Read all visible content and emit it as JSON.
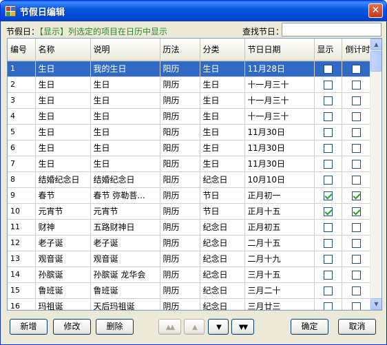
{
  "window": {
    "title": "节假日编辑",
    "close_glyph": "✕"
  },
  "toolbar": {
    "prefix": "节假日：",
    "highlight": "【显示】",
    "suffix": "列选定的项目在日历中显示",
    "search_label": "查找节日：",
    "search_value": ""
  },
  "table": {
    "columns": [
      "编号",
      "名称",
      "说明",
      "历法",
      "分类",
      "节日日期",
      "显示",
      "倒计时"
    ],
    "rows": [
      {
        "no": "1",
        "name": "生日",
        "desc": "我的生日",
        "calendar": "阳历",
        "category": "生日",
        "date": "11月28日",
        "show": false,
        "countdown": false,
        "selected": true
      },
      {
        "no": "2",
        "name": "生日",
        "desc": "生日",
        "calendar": "阴历",
        "category": "生日",
        "date": "十一月三十",
        "show": false,
        "countdown": false
      },
      {
        "no": "3",
        "name": "生日",
        "desc": "生日",
        "calendar": "阴历",
        "category": "生日",
        "date": "十一月三十",
        "show": false,
        "countdown": false
      },
      {
        "no": "4",
        "name": "生日",
        "desc": "生日",
        "calendar": "阴历",
        "category": "生日",
        "date": "十一月三十",
        "show": false,
        "countdown": false
      },
      {
        "no": "5",
        "name": "生日",
        "desc": "生日",
        "calendar": "阳历",
        "category": "生日",
        "date": "11月30日",
        "show": false,
        "countdown": false
      },
      {
        "no": "6",
        "name": "生日",
        "desc": "生日",
        "calendar": "阳历",
        "category": "生日",
        "date": "11月30日",
        "show": false,
        "countdown": false
      },
      {
        "no": "7",
        "name": "生日",
        "desc": "生日",
        "calendar": "阳历",
        "category": "生日",
        "date": "11月30日",
        "show": false,
        "countdown": false
      },
      {
        "no": "8",
        "name": "结婚纪念日",
        "desc": "结婚纪念日",
        "calendar": "阳历",
        "category": "纪念日",
        "date": "10月10日",
        "show": false,
        "countdown": false
      },
      {
        "no": "9",
        "name": "春节",
        "desc": "春节 弥勒菩...",
        "calendar": "阴历",
        "category": "节日",
        "date": "正月初一",
        "show": true,
        "countdown": true
      },
      {
        "no": "10",
        "name": "元宵节",
        "desc": "元宵节",
        "calendar": "阴历",
        "category": "节日",
        "date": "正月十五",
        "show": true,
        "countdown": true
      },
      {
        "no": "11",
        "name": "财神",
        "desc": "五路财神日",
        "calendar": "阴历",
        "category": "纪念日",
        "date": "正月初五",
        "show": false,
        "countdown": false
      },
      {
        "no": "12",
        "name": "老子诞",
        "desc": "老子诞",
        "calendar": "阴历",
        "category": "纪念日",
        "date": "二月十五",
        "show": false,
        "countdown": false
      },
      {
        "no": "13",
        "name": "观音诞",
        "desc": "观音诞",
        "calendar": "阴历",
        "category": "纪念日",
        "date": "二月十九",
        "show": false,
        "countdown": false
      },
      {
        "no": "14",
        "name": "孙膑诞",
        "desc": "孙膑诞 龙华会",
        "calendar": "阴历",
        "category": "纪念日",
        "date": "三月十五",
        "show": false,
        "countdown": false
      },
      {
        "no": "15",
        "name": "鲁班诞",
        "desc": "鲁班诞",
        "calendar": "阴历",
        "category": "纪念日",
        "date": "三月二十",
        "show": false,
        "countdown": false
      },
      {
        "no": "16",
        "name": "玛祖诞",
        "desc": "天后玛祖诞",
        "calendar": "阴历",
        "category": "纪念日",
        "date": "三月廿三",
        "show": false,
        "countdown": false
      }
    ]
  },
  "buttons": {
    "add": "新增",
    "edit": "修改",
    "delete": "删除",
    "move_top": "▲▲",
    "move_up": "▲",
    "move_down": "▼",
    "move_bottom": "▼▼",
    "ok": "确定",
    "cancel": "取消"
  }
}
